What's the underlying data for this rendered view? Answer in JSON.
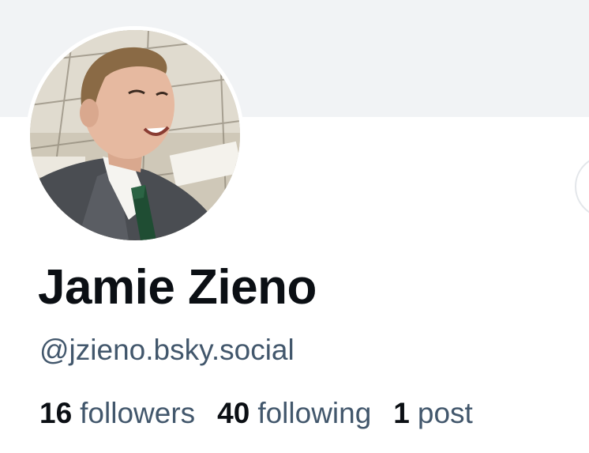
{
  "profile": {
    "display_name": "Jamie Zieno",
    "handle": "@jzieno.bsky.social",
    "avatar_icon": "profile-photo"
  },
  "stats": {
    "followers_count": "16",
    "followers_label": "followers",
    "following_count": "40",
    "following_label": "following",
    "posts_count": "1",
    "posts_label": "post"
  },
  "colors": {
    "banner": "#f1f3f5",
    "name_text": "#0b0f14",
    "secondary_text": "#42576c"
  }
}
